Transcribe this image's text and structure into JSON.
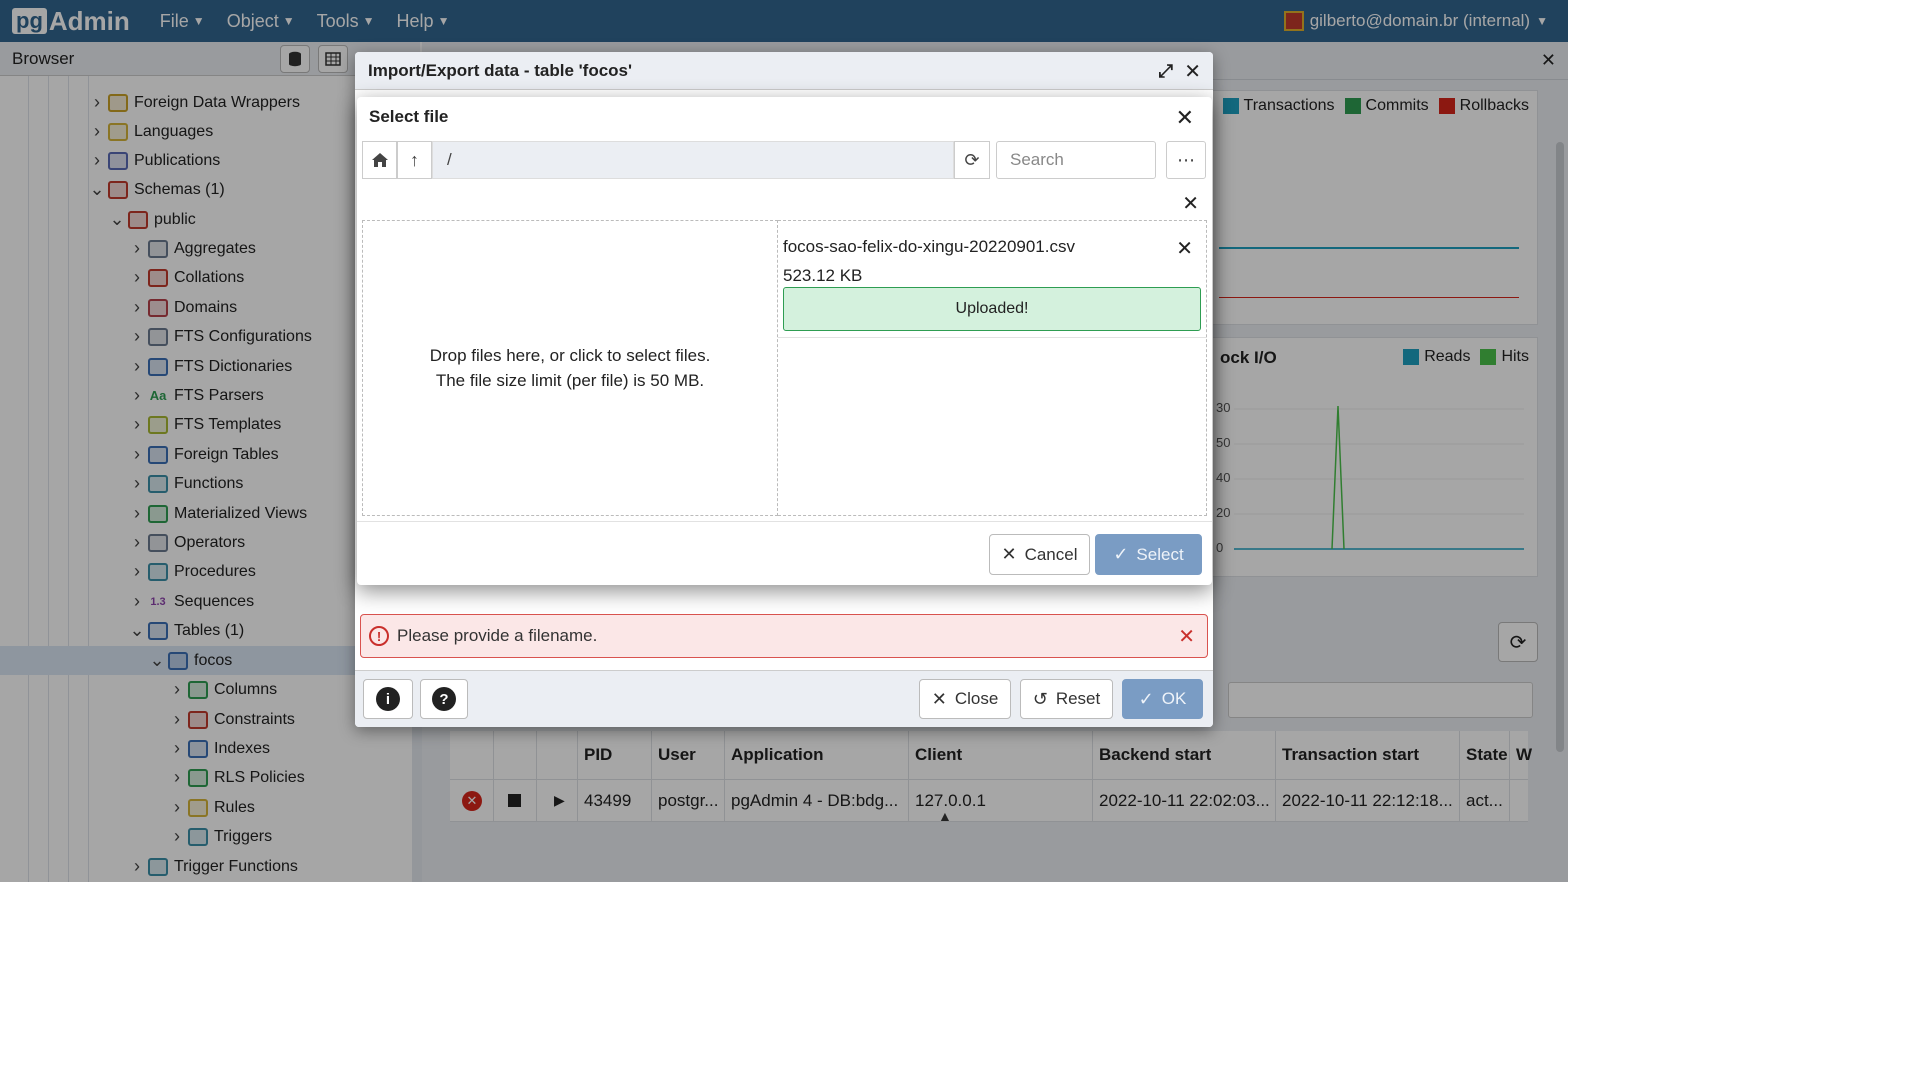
{
  "navbar": {
    "brand_prefix": "pg",
    "brand_suffix": "Admin",
    "menus": [
      "File",
      "Object",
      "Tools",
      "Help"
    ],
    "user": "gilberto@domain.br (internal)"
  },
  "browser": {
    "title": "Browser",
    "tree": [
      {
        "label": "Foreign Data Wrappers",
        "icon": "foreign-data-wrapper-icon",
        "color": "#c9a227"
      },
      {
        "label": "Languages",
        "icon": "language-icon",
        "color": "#d4b43a"
      },
      {
        "label": "Publications",
        "icon": "publication-icon",
        "color": "#5a6bb5"
      },
      {
        "label": "Schemas (1)",
        "icon": "schema-icon",
        "color": "#c0392b"
      },
      {
        "label": "public",
        "icon": "schema-public-icon",
        "color": "#c0392b"
      },
      {
        "label": "Aggregates",
        "icon": "aggregate-icon",
        "color": "#6b7a8f"
      },
      {
        "label": "Collations",
        "icon": "collation-icon",
        "color": "#c0392b"
      },
      {
        "label": "Domains",
        "icon": "domain-icon",
        "color": "#b5414b"
      },
      {
        "label": "FTS Configurations",
        "icon": "fts-configuration-icon",
        "color": "#6b7a8f"
      },
      {
        "label": "FTS Dictionaries",
        "icon": "fts-dictionary-icon",
        "color": "#3b6fb6"
      },
      {
        "label": "FTS Parsers",
        "icon": "fts-parser-icon",
        "color": "#2e9d52"
      },
      {
        "label": "FTS Templates",
        "icon": "fts-template-icon",
        "color": "#a8b832"
      },
      {
        "label": "Foreign Tables",
        "icon": "foreign-table-icon",
        "color": "#3b6fb6"
      },
      {
        "label": "Functions",
        "icon": "function-icon",
        "color": "#3b8fa8"
      },
      {
        "label": "Materialized Views",
        "icon": "materialized-view-icon",
        "color": "#2e9d52"
      },
      {
        "label": "Operators",
        "icon": "operator-icon",
        "color": "#6b7a8f"
      },
      {
        "label": "Procedures",
        "icon": "procedure-icon",
        "color": "#3b8fa8"
      },
      {
        "label": "Sequences",
        "icon": "sequence-icon",
        "color": "#8e44ad"
      },
      {
        "label": "Tables (1)",
        "icon": "tables-icon",
        "color": "#3b6fb6"
      },
      {
        "label": "focos",
        "icon": "table-icon",
        "color": "#3b6fb6"
      },
      {
        "label": "Columns",
        "icon": "columns-icon",
        "color": "#2e9d52"
      },
      {
        "label": "Constraints",
        "icon": "constraint-icon",
        "color": "#c0392b"
      },
      {
        "label": "Indexes",
        "icon": "index-icon",
        "color": "#3b6fb6"
      },
      {
        "label": "RLS Policies",
        "icon": "rls-policy-icon",
        "color": "#2e9d52"
      },
      {
        "label": "Rules",
        "icon": "rule-icon",
        "color": "#d4b43a"
      },
      {
        "label": "Triggers",
        "icon": "trigger-icon",
        "color": "#3b8fa8"
      },
      {
        "label": "Trigger Functions",
        "icon": "trigger-function-icon",
        "color": "#3b8fa8"
      }
    ],
    "sequence_glyph": "1.3",
    "parser_glyph": "Aa"
  },
  "dashboard": {
    "legend_tx": [
      "Transactions",
      "Commits",
      "Rollbacks"
    ],
    "legend_io": [
      "Reads",
      "Hits"
    ],
    "block_io_title": "ock I/O",
    "io_ticks": [
      "30",
      "50",
      "40",
      "20",
      "0"
    ],
    "colors": {
      "transactions": "#1ea0c1",
      "commits": "#2e9d52",
      "rollbacks": "#d8261b",
      "reads": "#1ea0c1",
      "hits": "#4bc24b"
    },
    "columns": [
      "PID",
      "User",
      "Application",
      "Client",
      "Backend start",
      "Transaction start",
      "State",
      "W"
    ],
    "row": {
      "pid": "43499",
      "user": "postgr...",
      "application": "pgAdmin 4 - DB:bdg...",
      "client": "127.0.0.1",
      "backend_start": "2022-10-11 22:02:03...",
      "transaction_start": "2022-10-11 22:12:18...",
      "state": "act..."
    }
  },
  "import_dialog": {
    "title": "Import/Export data - table 'focos'",
    "error": "Please provide a filename.",
    "close_label": "Close",
    "reset_label": "Reset",
    "ok_label": "OK"
  },
  "select_file": {
    "title": "Select file",
    "path": "/",
    "search_placeholder": "Search",
    "drop_line1": "Drop files here, or click to select files.",
    "drop_line2": "The file size limit (per file) is 50 MB.",
    "file_name": "focos-sao-felix-do-xingu-20220901.csv",
    "file_size": "523.12 KB",
    "status": "Uploaded!",
    "cancel_label": "Cancel",
    "select_label": "Select"
  }
}
